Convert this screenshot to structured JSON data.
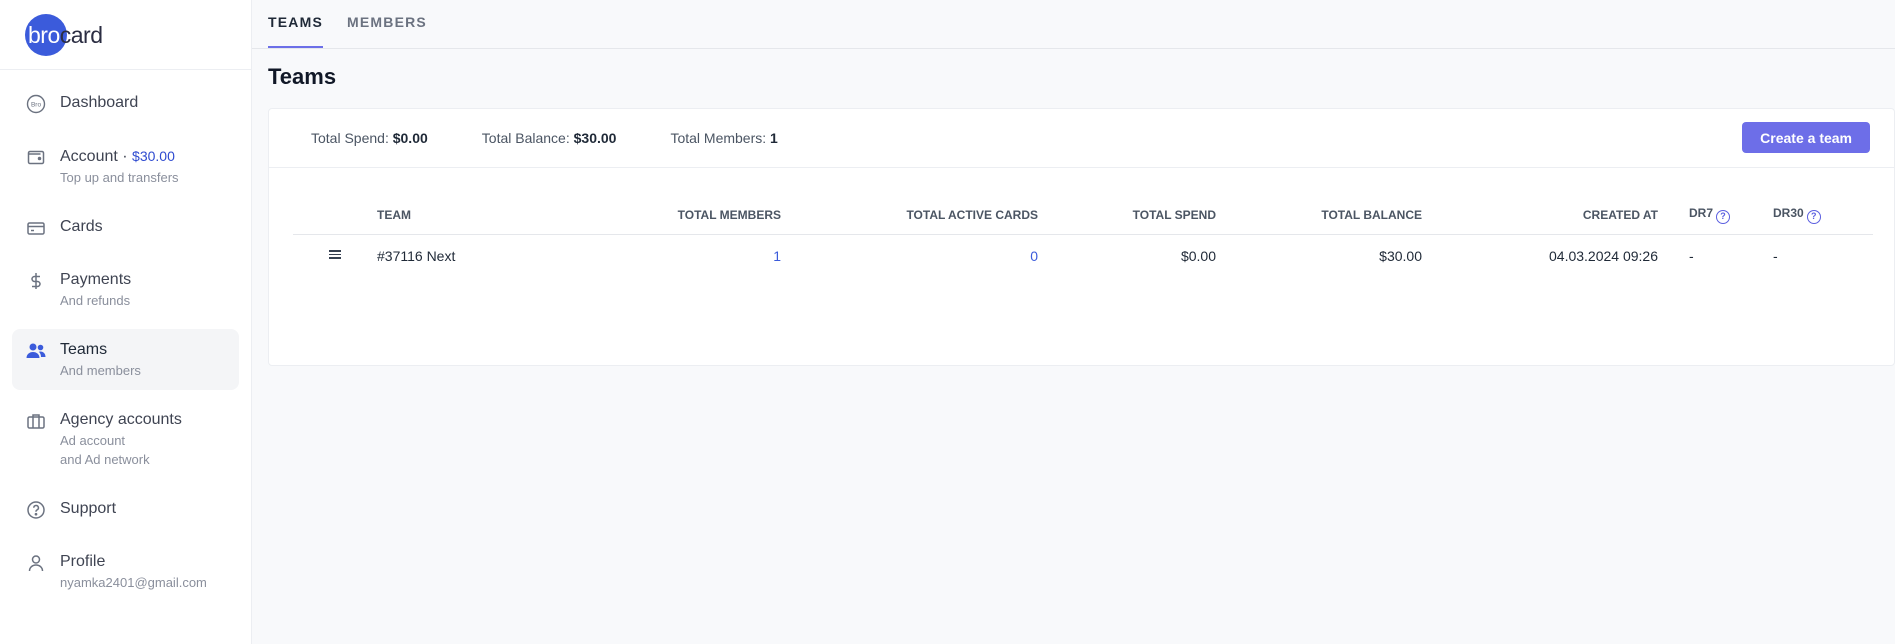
{
  "brand": {
    "logo_bro": "bro",
    "logo_card": "card"
  },
  "sidebar": {
    "items": [
      {
        "label": "Dashboard",
        "sub": "",
        "icon": "bro-coin-icon"
      },
      {
        "label": "Account",
        "amount": "$30.00",
        "sub": "Top up and transfers",
        "icon": "wallet-icon"
      },
      {
        "label": "Cards",
        "sub": "",
        "icon": "credit-card-icon"
      },
      {
        "label": "Payments",
        "sub": "And refunds",
        "icon": "dollar-icon"
      },
      {
        "label": "Teams",
        "sub": "And members",
        "icon": "users-icon",
        "active": true
      },
      {
        "label": "Agency accounts",
        "sub": "Ad account",
        "sub2": "and Ad network",
        "icon": "briefcase-icon"
      },
      {
        "label": "Support",
        "sub": "",
        "icon": "help-circle-icon"
      },
      {
        "label": "Profile",
        "sub": "nyamka2401@gmail.com",
        "icon": "user-icon"
      }
    ],
    "account_sep": " · "
  },
  "tabs": [
    {
      "label": "TEAMS",
      "active": true
    },
    {
      "label": "MEMBERS",
      "active": false
    }
  ],
  "page": {
    "title": "Teams"
  },
  "summary": {
    "spend_label": "Total Spend:",
    "spend_value": "$0.00",
    "balance_label": "Total Balance:",
    "balance_value": "$30.00",
    "members_label": "Total Members:",
    "members_value": "1",
    "create_button": "Create a team"
  },
  "table": {
    "columns": [
      "TEAM",
      "TOTAL MEMBERS",
      "TOTAL ACTIVE CARDS",
      "TOTAL SPEND",
      "TOTAL BALANCE",
      "CREATED AT",
      "DR7",
      "DR30"
    ],
    "rows": [
      {
        "team": "#37116 Next",
        "members": "1",
        "active_cards": "0",
        "spend": "$0.00",
        "balance": "$30.00",
        "created_at": "04.03.2024 09:26",
        "dr7": "-",
        "dr30": "-"
      }
    ]
  },
  "colors": {
    "accent": "#6d6ee8",
    "brand": "#3b5bdb",
    "link": "#3b5bdb"
  }
}
